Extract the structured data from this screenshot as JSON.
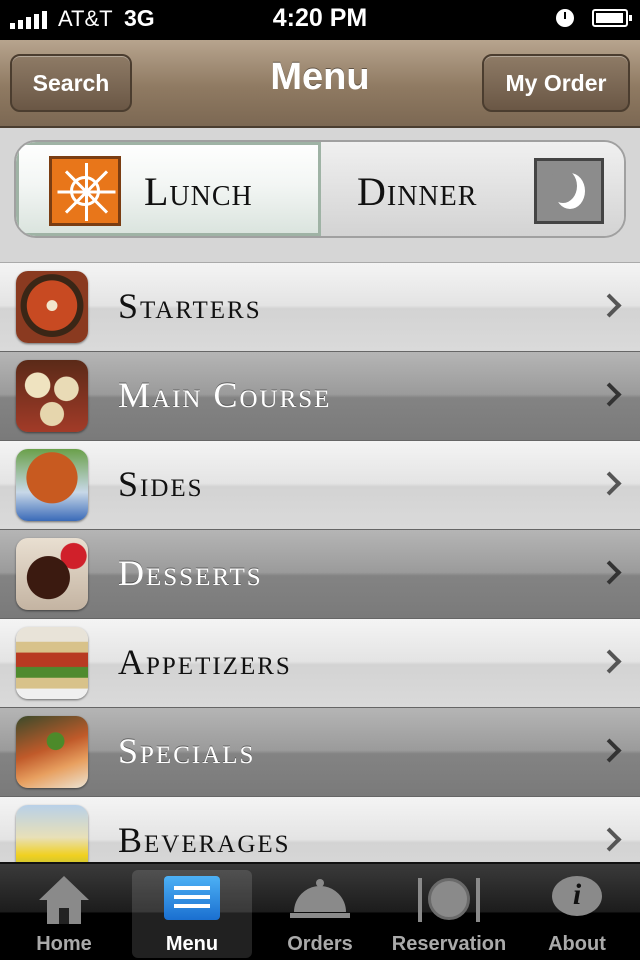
{
  "status_bar": {
    "carrier": "AT&T",
    "network": "3G",
    "time": "4:20 PM"
  },
  "nav": {
    "title": "Menu",
    "left_button": "Search",
    "right_button": "My Order"
  },
  "meal_toggle": {
    "options": [
      {
        "label": "Lunch",
        "icon": "sun-icon",
        "selected": true
      },
      {
        "label": "Dinner",
        "icon": "moon-icon",
        "selected": false
      }
    ]
  },
  "categories": [
    {
      "label": "Starters"
    },
    {
      "label": "Main Course"
    },
    {
      "label": "Sides"
    },
    {
      "label": "Desserts"
    },
    {
      "label": "Appetizers"
    },
    {
      "label": "Specials"
    },
    {
      "label": "Beverages"
    }
  ],
  "tabs": [
    {
      "label": "Home",
      "icon": "home-icon",
      "active": false
    },
    {
      "label": "Menu",
      "icon": "menu-icon",
      "active": true
    },
    {
      "label": "Orders",
      "icon": "cloche-icon",
      "active": false
    },
    {
      "label": "Reservation",
      "icon": "plate-icon",
      "active": false
    },
    {
      "label": "About",
      "icon": "info-icon",
      "active": false
    }
  ],
  "colors": {
    "nav_brown": "#8f7a62",
    "accent_blue": "#1a6fd0",
    "sun_orange": "#e8761a"
  }
}
